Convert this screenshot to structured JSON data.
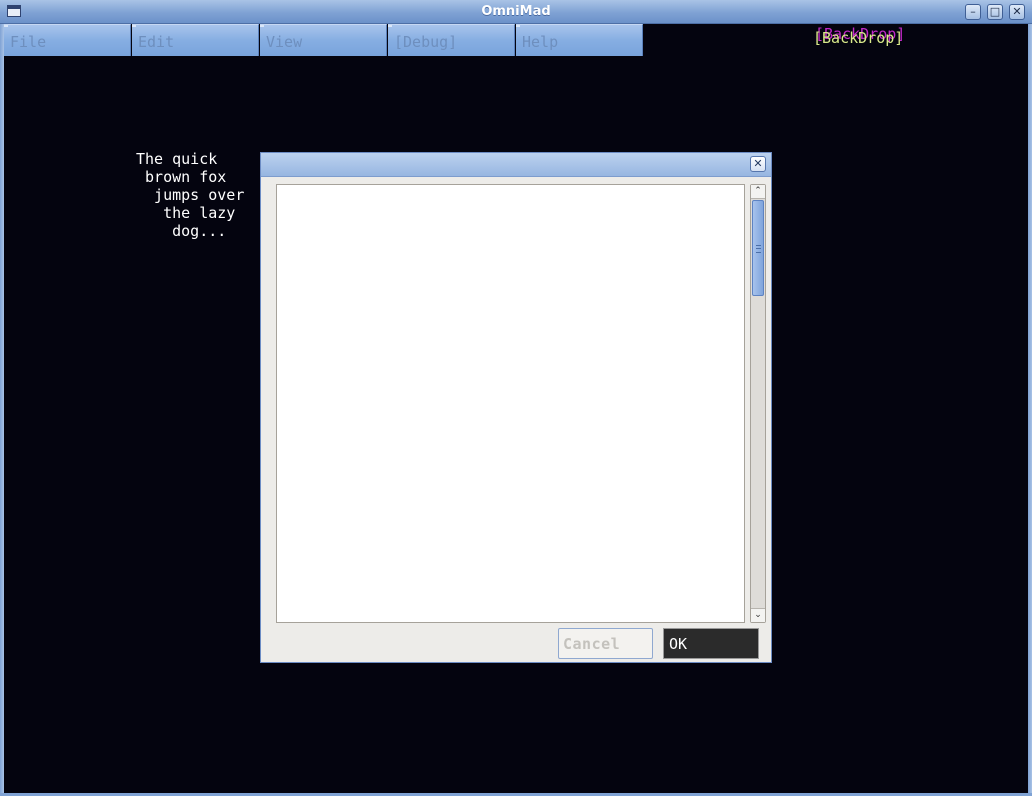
{
  "window": {
    "title": "OmniMad"
  },
  "menubar": {
    "items": [
      "File",
      "Edit",
      "View",
      "[Debug]",
      "Help"
    ]
  },
  "backdrop": {
    "label": "[BackDrop]"
  },
  "pangram": {
    "lines": [
      "The quick",
      " brown fox",
      "  jumps over",
      "   the lazy",
      "    dog..."
    ]
  },
  "dialog": {
    "text_value": "",
    "cancel_label": "Cancel",
    "ok_label": "OK"
  },
  "colors": {
    "background": "#04040f",
    "titlebar": "#7fa2d4",
    "backdrop_text": "#d8e98a",
    "backdrop_ghost": "#c229c8"
  }
}
